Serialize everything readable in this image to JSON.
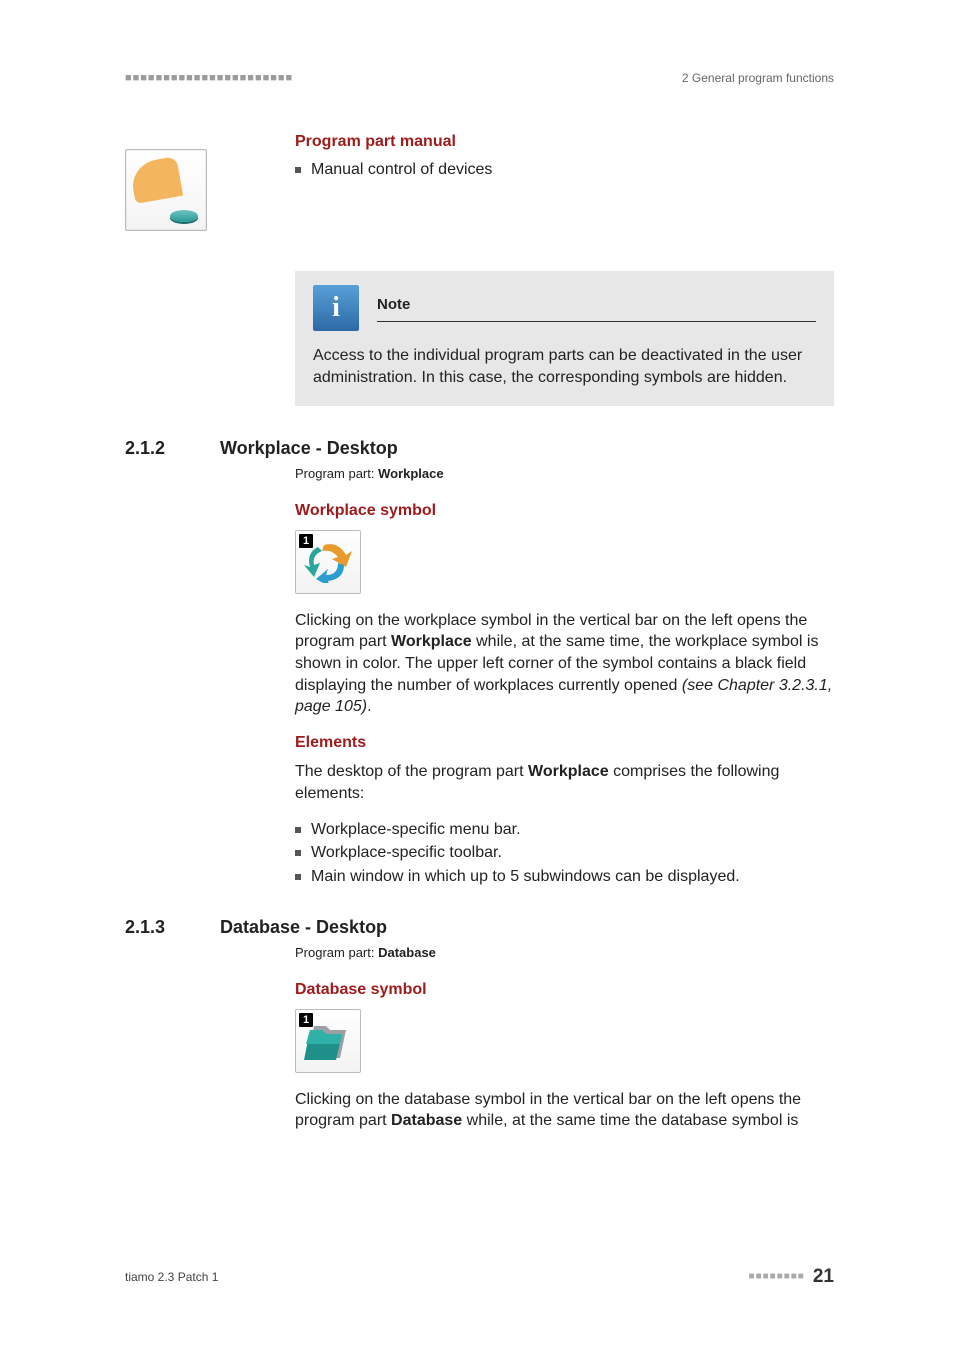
{
  "runhead": {
    "left": "■■■■■■■■■■■■■■■■■■■■■■",
    "right": "2 General program functions"
  },
  "s1": {
    "heading": "Program part manual",
    "bullets": [
      "Manual control of devices"
    ]
  },
  "note": {
    "title": "Note",
    "body": "Access to the individual program parts can be deactivated in the user administration. In this case, the corresponding symbols are hidden."
  },
  "s212": {
    "num": "2.1.2",
    "title": "Workplace - Desktop",
    "part_label": "Program part: ",
    "part_value": "Workplace",
    "sym_head": "Workplace symbol",
    "badge": "1",
    "para1a": "Clicking on the workplace symbol in the vertical bar on the left opens the program part ",
    "para1b": "Workplace",
    "para1c": " while, at the same time, the workplace symbol is shown in color. The upper left corner of the symbol contains a black field displaying the number of workplaces currently opened ",
    "para1d": "(see Chapter 3.2.3.1, page 105)",
    "para1e": ".",
    "elem_head": "Elements",
    "elem_intro_a": "The desktop of the program part ",
    "elem_intro_b": "Workplace",
    "elem_intro_c": " comprises the following elements:",
    "bullets": [
      "Workplace-specific menu bar.",
      "Workplace-specific toolbar.",
      "Main window in which up to 5 subwindows can be displayed."
    ]
  },
  "s213": {
    "num": "2.1.3",
    "title": "Database - Desktop",
    "part_label": "Program part: ",
    "part_value": "Database",
    "sym_head": "Database symbol",
    "badge": "1",
    "para1a": "Clicking on the database symbol in the vertical bar on the left opens the program part ",
    "para1b": "Database",
    "para1c": " while, at the same time the database symbol is"
  },
  "footer": {
    "left": "tiamo 2.3 Patch 1",
    "dots": "■■■■■■■■",
    "num": "21"
  }
}
